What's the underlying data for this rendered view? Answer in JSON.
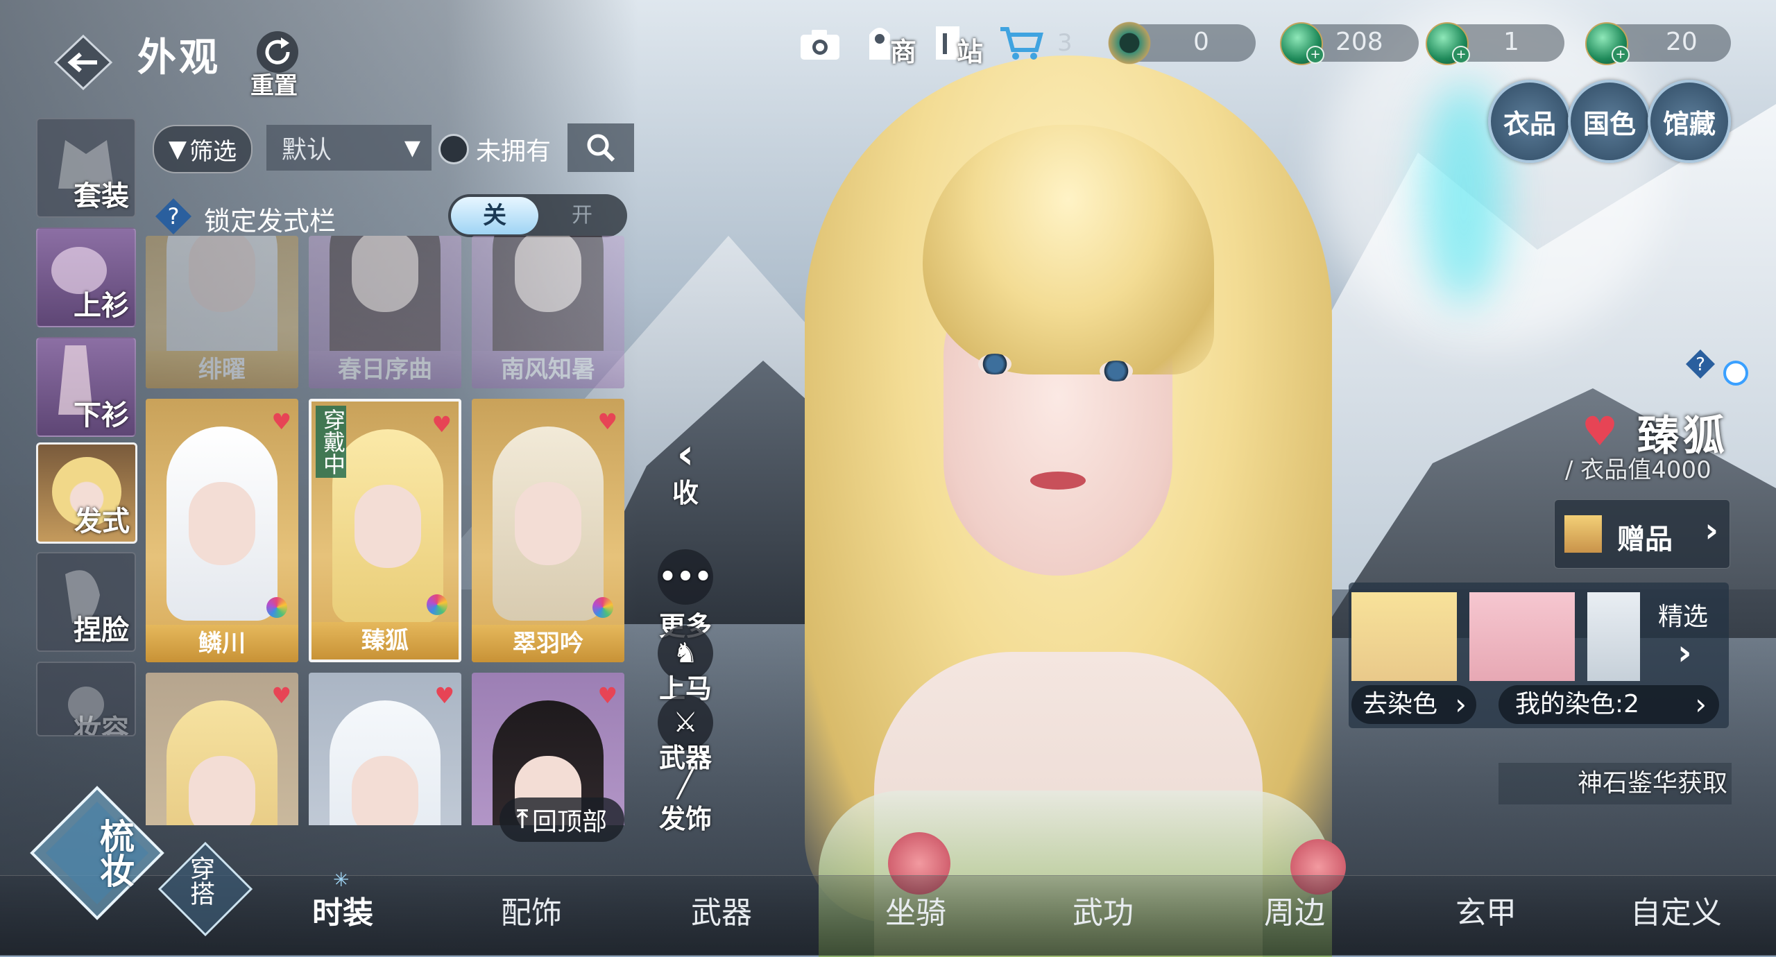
{
  "header": {
    "title": "外观",
    "reset_label": "重置"
  },
  "top_bar": {
    "shop_label": "商",
    "station_label": "站",
    "cart_count": "3",
    "currencies": [
      {
        "icon": "jade-ring-icon",
        "value": "0"
      },
      {
        "icon": "green-gem-icon",
        "value": "208"
      },
      {
        "icon": "green-gem-icon",
        "value": "1"
      },
      {
        "icon": "green-gem-icon",
        "value": "20"
      }
    ],
    "round_buttons": [
      "衣品",
      "国色",
      "馆藏"
    ]
  },
  "filter": {
    "filter_label": "筛选",
    "sort_value": "默认",
    "unowned_label": "未拥有",
    "lock_label": "锁定发式栏",
    "toggle_off": "关",
    "toggle_on": "开"
  },
  "side_tabs": [
    "套装",
    "上衫",
    "下衫",
    "发式",
    "捏脸",
    "妆容"
  ],
  "cards": [
    {
      "name": "绯曜",
      "state": "faded"
    },
    {
      "name": "春日序曲",
      "state": "faded"
    },
    {
      "name": "南风知暑",
      "state": "faded"
    },
    {
      "name": "鳞川",
      "state": "normal"
    },
    {
      "name": "臻狐",
      "state": "wearing"
    },
    {
      "name": "翠羽吟",
      "state": "normal"
    },
    {
      "name": "",
      "state": "normal"
    },
    {
      "name": "",
      "state": "normal"
    },
    {
      "name": "",
      "state": "normal"
    }
  ],
  "wearing_label": "穿戴中",
  "back_to_top_label": "回顶部",
  "actions": {
    "collapse": "收",
    "more": "更多",
    "mount": "上马",
    "weapon": "武器",
    "hair_accessory": "发饰"
  },
  "item_info": {
    "name": "臻狐",
    "value_text": "/ 衣品值4000",
    "gift_label": "赠品",
    "featured_label": "精选",
    "remove_dye_label": "去染色",
    "my_dye_label": "我的染色:2",
    "source_text": "神石鉴华获取"
  },
  "bottom_tabs": [
    "时装",
    "配饰",
    "武器",
    "坐骑",
    "武功",
    "周边",
    "玄甲",
    "自定义"
  ],
  "mode_buttons": {
    "makeup": "梳妆",
    "outfit": "穿搭"
  },
  "colors": {
    "accent_gold": "#e5b85c",
    "heart_red": "#e74455",
    "panel_dark": "#2f3a46"
  }
}
